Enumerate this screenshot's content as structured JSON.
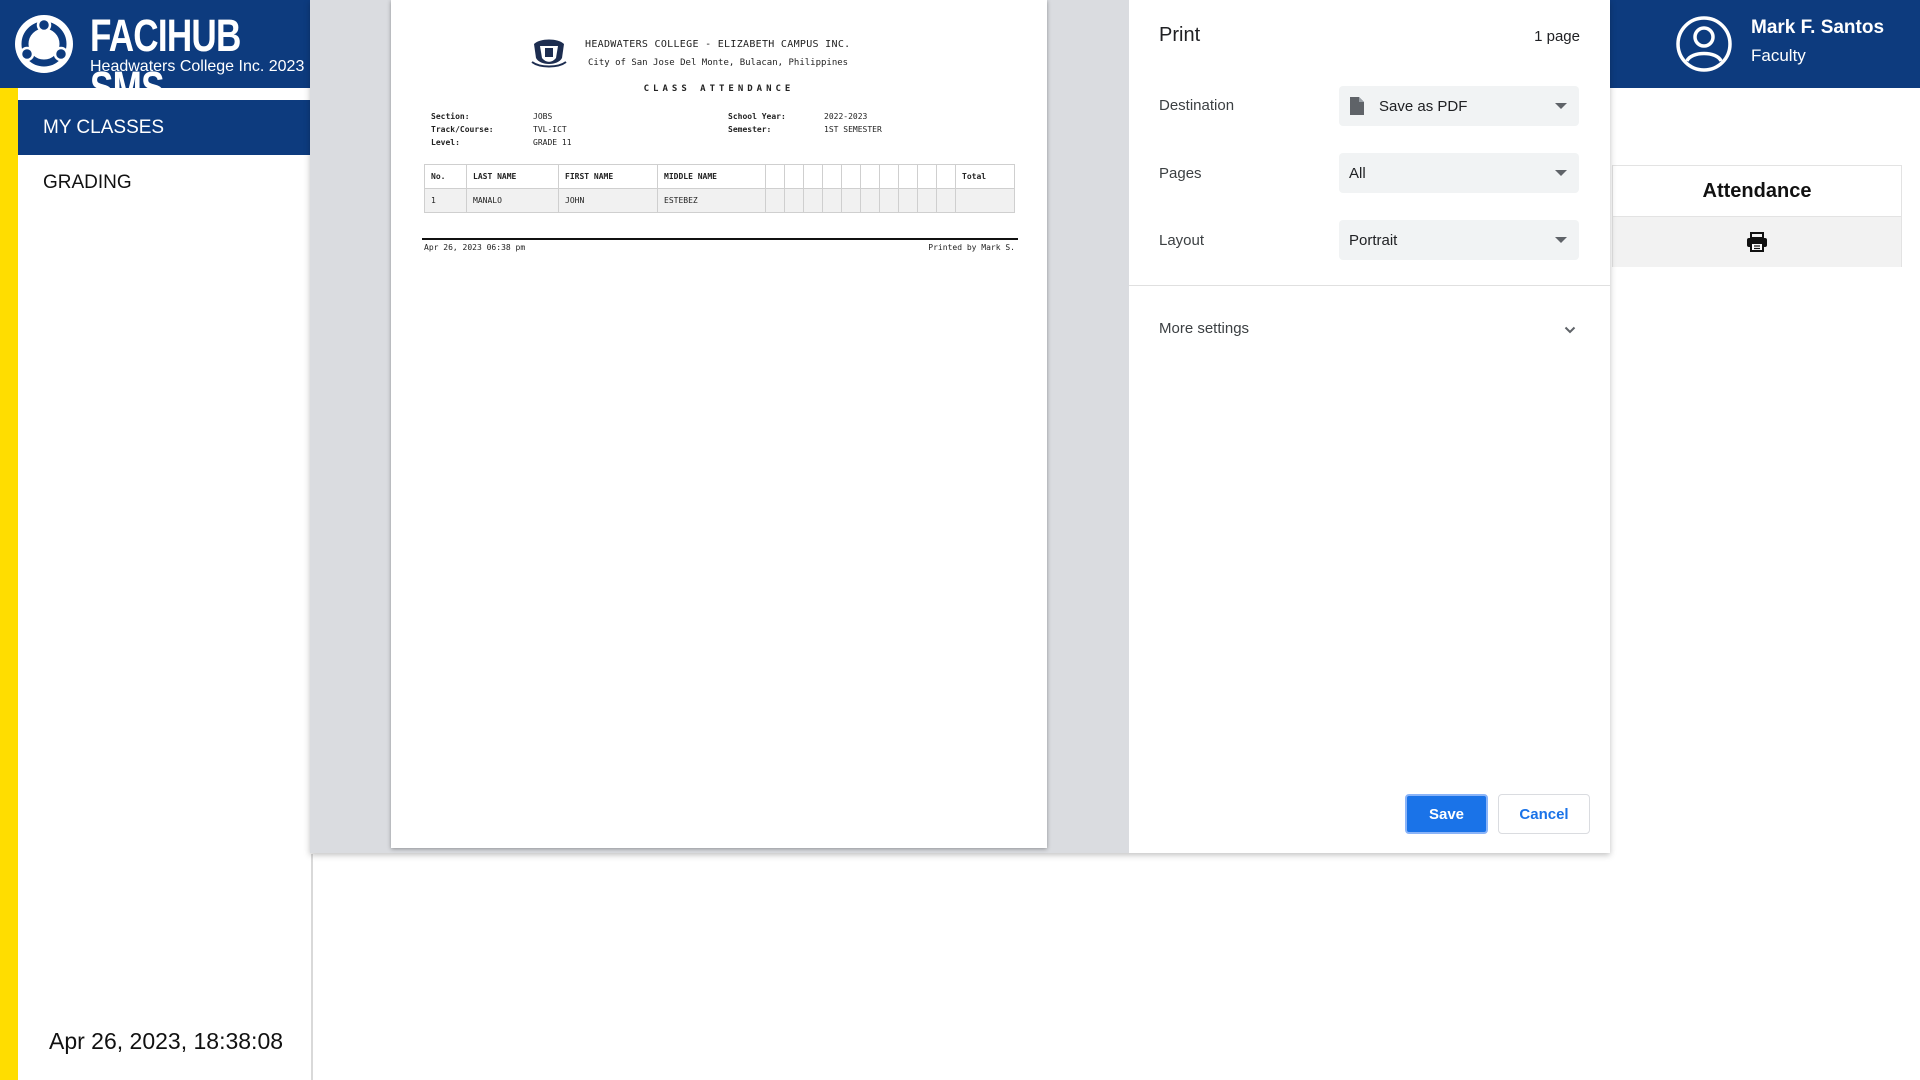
{
  "brand": {
    "title": "FACIHUB SMS",
    "subtitle": "Headwaters College Inc. 2023"
  },
  "sidebar": {
    "items": [
      {
        "label": "MY CLASSES",
        "active": true
      },
      {
        "label": "GRADING",
        "active": false
      }
    ],
    "clock": "Apr 26, 2023, 18:38:08"
  },
  "user": {
    "name": "Mark F. Santos",
    "role": "Faculty"
  },
  "attendance_card": {
    "title": "Attendance",
    "icon": "printer-icon"
  },
  "print_dialog": {
    "title": "Print",
    "page_count": "1 page",
    "destination": {
      "label": "Destination",
      "value": "Save as PDF"
    },
    "pages": {
      "label": "Pages",
      "value": "All"
    },
    "layout": {
      "label": "Layout",
      "value": "Portrait"
    },
    "more_settings": "More settings",
    "save_label": "Save",
    "cancel_label": "Cancel",
    "accent_color": "#1a73e8"
  },
  "document": {
    "school": "HEADWATERS COLLEGE - ELIZABETH CAMPUS INC.",
    "address": "City of San Jose Del Monte, Bulacan, Philippines",
    "title": "CLASS ATTENDANCE",
    "info": {
      "section_label": "Section:",
      "section": "JOBS",
      "track_label": "Track/Course:",
      "track": "TVL-ICT",
      "level_label": "Level:",
      "level": "GRADE 11",
      "school_year_label": "School Year:",
      "school_year": "2022-2023",
      "semester_label": "Semester:",
      "semester": "1ST SEMESTER"
    },
    "table": {
      "headers": [
        "No.",
        "LAST NAME",
        "FIRST NAME",
        "MIDDLE NAME",
        "Total"
      ],
      "rows": [
        [
          "1",
          "MANALO",
          "JOHN",
          "ESTEBEZ",
          ""
        ]
      ]
    },
    "footer_left": "Apr 26, 2023 06:38 pm",
    "footer_right": "Printed by Mark S."
  }
}
